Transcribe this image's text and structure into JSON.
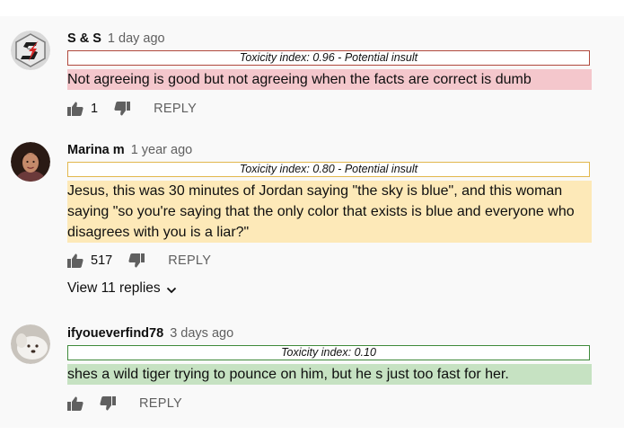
{
  "comments": [
    {
      "author": "S & S",
      "time": "1 day ago",
      "toxicity_label": "Toxicity index: 0.96 - Potential insult",
      "text": "Not agreeing is good but not agreeing when the facts are correct is dumb",
      "likes": "1",
      "reply_label": "REPLY",
      "highlight_color": "#f4c7cc",
      "border_color": "#b0483c",
      "avatar_icon": "s-and-s-logo"
    },
    {
      "author": "Marina m",
      "time": "1 year ago",
      "toxicity_label": "Toxicity index: 0.80 - Potential insult",
      "text": "Jesus, this was 30 minutes of Jordan saying \"the sky is blue\", and this woman saying \"so you're saying that the only color that exists is blue and everyone who disagrees with you is a liar?\"",
      "likes": "517",
      "reply_label": "REPLY",
      "view_replies": "View 11 replies",
      "highlight_color": "#fde9b8",
      "border_color": "#e2b84e",
      "avatar_icon": "profile-photo"
    },
    {
      "author": "ifyoueverfind78",
      "time": "3 days ago",
      "toxicity_label": "Toxicity index: 0.10",
      "text": "shes a wild tiger trying to pounce on him, but he s just too fast for her.",
      "likes": "",
      "reply_label": "REPLY",
      "highlight_color": "#c6e2c2",
      "border_color": "#3f8a3a",
      "avatar_icon": "dog-photo"
    }
  ]
}
